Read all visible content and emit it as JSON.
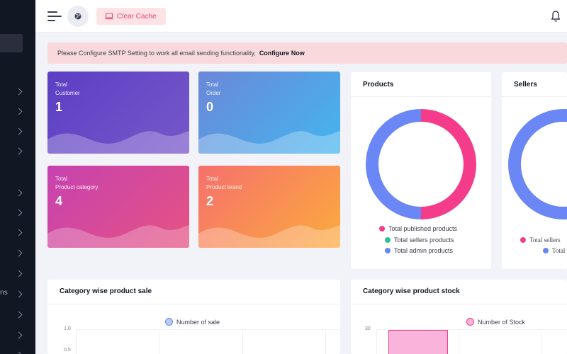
{
  "sidebar": {
    "fragment_text": "ns",
    "chevron_rows": 13
  },
  "header": {
    "menu_icon": "hamburger-icon",
    "globe_icon": "globe-icon",
    "clear_cache_label": "Clear Cache",
    "clear_cache_icon": "laptop-icon",
    "bell_icon": "bell-icon"
  },
  "alert": {
    "message": "Please Configure SMTP Setting to work all email sending functionality,",
    "link_label": "Configure Now"
  },
  "stats": [
    {
      "label_line1": "Total",
      "label_line2": "Customer",
      "value": "1"
    },
    {
      "label_line1": "Total",
      "label_line2": "Order",
      "value": "0"
    },
    {
      "label_line1": "Total",
      "label_line2": "Product category",
      "value": "4"
    },
    {
      "label_line1": "Total",
      "label_line2": "Product brand",
      "value": "2"
    }
  ],
  "products_panel": {
    "title": "Products",
    "legend": [
      "Total published products",
      "Total sellers products",
      "Total admin products"
    ]
  },
  "sellers_panel": {
    "title": "Sellers",
    "legend": [
      "Total sellers",
      "Total p"
    ]
  },
  "sale_panel": {
    "title": "Category wise product sale",
    "legend": "Number of sale",
    "y_ticks": [
      "1.0",
      "0.5"
    ]
  },
  "stock_panel": {
    "title": "Category wise product stock",
    "legend": "Number of Stock",
    "y_ticks": [
      "30"
    ]
  },
  "colors": {
    "sidebar_bg": "#111723",
    "pink": "#f53c8a",
    "blue": "#6b86f5",
    "green": "#2bc28f",
    "alert_bg": "#f9d9dc",
    "clear_cache_text": "#e8496b"
  },
  "chart_data": [
    {
      "type": "pie",
      "title": "Products",
      "labels": [
        "Total published products",
        "Total sellers products",
        "Total admin products"
      ],
      "values": [
        1,
        0,
        1
      ],
      "colors": [
        "#f53c8a",
        "#2bc28f",
        "#6b86f5"
      ]
    },
    {
      "type": "pie",
      "title": "Sellers",
      "labels": [
        "Total sellers",
        "Total p"
      ],
      "values": [
        0,
        1
      ],
      "colors": [
        "#f53c8a",
        "#6b86f5"
      ]
    },
    {
      "type": "bar",
      "title": "Category wise product sale",
      "series": [
        {
          "name": "Number of sale",
          "values": []
        }
      ],
      "ylim": [
        0,
        1.0
      ]
    },
    {
      "type": "bar",
      "title": "Category wise product stock",
      "series": [
        {
          "name": "Number of Stock",
          "values": [
            30
          ]
        }
      ],
      "ylim": [
        0,
        30
      ]
    }
  ]
}
